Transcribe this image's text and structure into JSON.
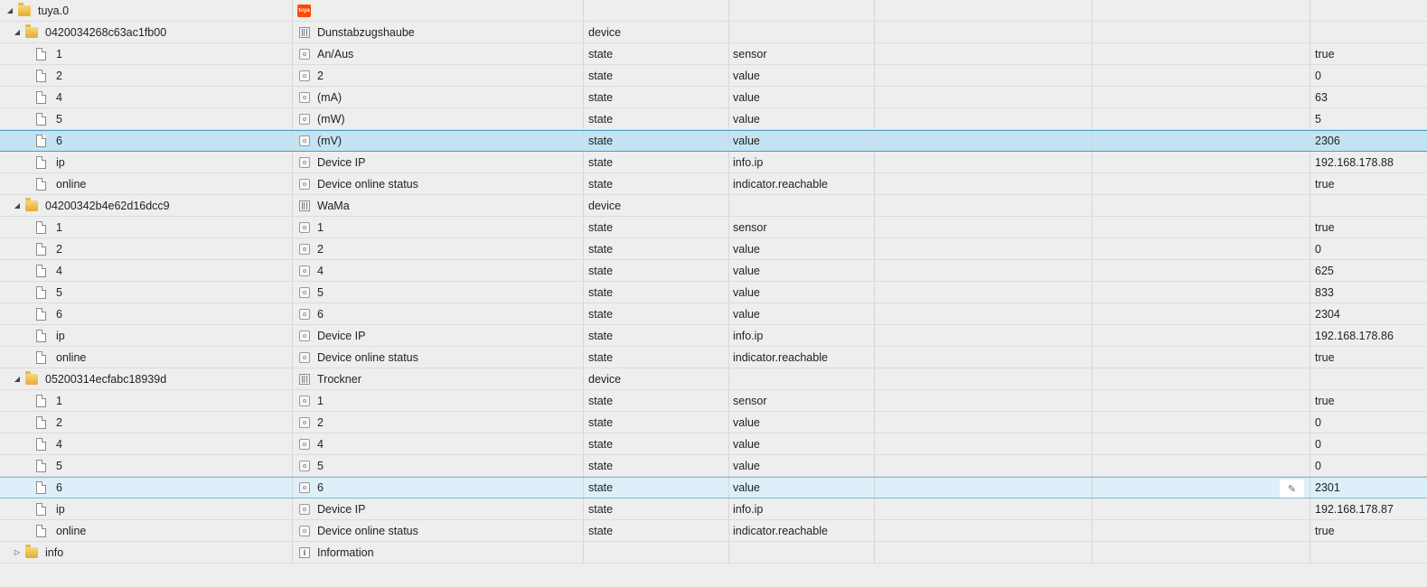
{
  "root": {
    "id": "tuya.0",
    "logo_text": "tuya"
  },
  "devices": [
    {
      "id": "0420034268c63ac1fb00",
      "name": "Dunstabzugshaube",
      "type": "device",
      "states": [
        {
          "id": "1",
          "name": "An/Aus",
          "type": "state",
          "role": "sensor",
          "value": "true"
        },
        {
          "id": "2",
          "name": "2",
          "type": "state",
          "role": "value",
          "value": "0"
        },
        {
          "id": "4",
          "name": "(mA)",
          "type": "state",
          "role": "value",
          "value": "63"
        },
        {
          "id": "5",
          "name": "(mW)",
          "type": "state",
          "role": "value",
          "value": "5"
        },
        {
          "id": "6",
          "name": "(mV)",
          "type": "state",
          "role": "value",
          "value": "2306",
          "selected": true
        },
        {
          "id": "ip",
          "name": "Device IP",
          "type": "state",
          "role": "info.ip",
          "value": "192.168.178.88"
        },
        {
          "id": "online",
          "name": "Device online status",
          "type": "state",
          "role": "indicator.reachable",
          "value": "true"
        }
      ]
    },
    {
      "id": "04200342b4e62d16dcc9",
      "name": "WaMa",
      "type": "device",
      "states": [
        {
          "id": "1",
          "name": "1",
          "type": "state",
          "role": "sensor",
          "value": "true"
        },
        {
          "id": "2",
          "name": "2",
          "type": "state",
          "role": "value",
          "value": "0"
        },
        {
          "id": "4",
          "name": "4",
          "type": "state",
          "role": "value",
          "value": "625"
        },
        {
          "id": "5",
          "name": "5",
          "type": "state",
          "role": "value",
          "value": "833"
        },
        {
          "id": "6",
          "name": "6",
          "type": "state",
          "role": "value",
          "value": "2304"
        },
        {
          "id": "ip",
          "name": "Device IP",
          "type": "state",
          "role": "info.ip",
          "value": "192.168.178.86"
        },
        {
          "id": "online",
          "name": "Device online status",
          "type": "state",
          "role": "indicator.reachable",
          "value": "true"
        }
      ]
    },
    {
      "id": "05200314ecfabc18939d",
      "name": "Trockner",
      "type": "device",
      "states": [
        {
          "id": "1",
          "name": "1",
          "type": "state",
          "role": "sensor",
          "value": "true"
        },
        {
          "id": "2",
          "name": "2",
          "type": "state",
          "role": "value",
          "value": "0"
        },
        {
          "id": "4",
          "name": "4",
          "type": "state",
          "role": "value",
          "value": "0"
        },
        {
          "id": "5",
          "name": "5",
          "type": "state",
          "role": "value",
          "value": "0"
        },
        {
          "id": "6",
          "name": "6",
          "type": "state",
          "role": "value",
          "value": "2301",
          "hovered": true
        },
        {
          "id": "ip",
          "name": "Device IP",
          "type": "state",
          "role": "info.ip",
          "value": "192.168.178.87"
        },
        {
          "id": "online",
          "name": "Device online status",
          "type": "state",
          "role": "indicator.reachable",
          "value": "true"
        }
      ]
    }
  ],
  "info": {
    "id": "info",
    "name": "Information"
  },
  "icons": {
    "expanded": "triangle-down-icon",
    "collapsed": "triangle-right-icon",
    "folder": "folder-icon",
    "file": "file-icon",
    "state": "state-icon",
    "device": "device-icon",
    "information": "info-icon",
    "edit": "pencil-icon"
  },
  "colors": {
    "background": "#eeeeee",
    "selected": "#c3e3f2",
    "tuya_logo": "#ff4800"
  }
}
